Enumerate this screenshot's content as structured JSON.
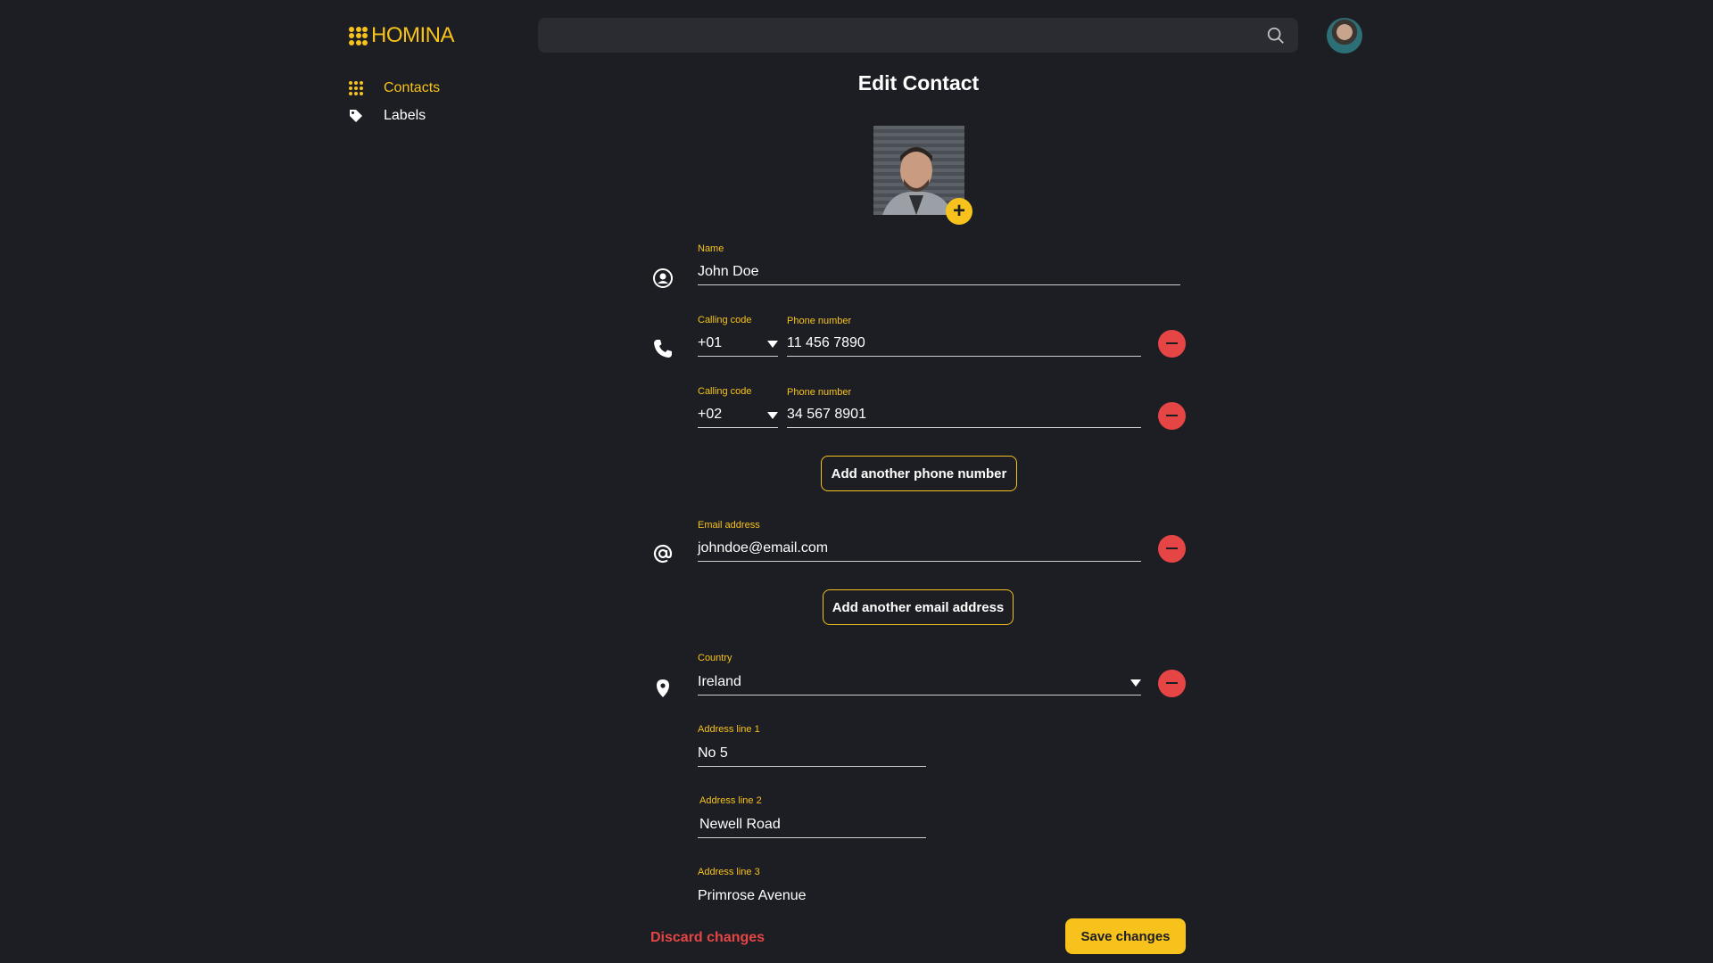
{
  "app": {
    "name": "HOMINA",
    "brand_color": "#f7c21b"
  },
  "search": {
    "placeholder": "",
    "value": "",
    "icon": "search-icon"
  },
  "sidebar": {
    "items": [
      {
        "label": "Contacts",
        "icon": "contacts-grid-icon",
        "active": true
      },
      {
        "label": "Labels",
        "icon": "tag-icon",
        "active": false
      }
    ]
  },
  "page": {
    "title": "Edit Contact"
  },
  "photo": {
    "add_icon": "plus-icon"
  },
  "form": {
    "name": {
      "label": "Name",
      "value": "John Doe",
      "icon": "person-circle-icon"
    },
    "phones": [
      {
        "calling_code_label": "Calling code",
        "calling_code": "+01",
        "phone_label": "Phone number",
        "phone": "11 456 7890"
      },
      {
        "calling_code_label": "Calling code",
        "calling_code": "+02",
        "phone_label": "Phone number",
        "phone": "34 567 8901"
      }
    ],
    "phone_icon": "phone-icon",
    "add_phone_label": "Add another phone number",
    "email": {
      "label": "Email address",
      "value": "johndoe@email.com",
      "icon": "at-icon"
    },
    "add_email_label": "Add another email address",
    "address": {
      "icon": "location-pin-icon",
      "country_label": "Country",
      "country": "Ireland",
      "line1_label": "Address line 1",
      "line1": "No 5",
      "line2_label": "Address line 2",
      "line2": "Newell Road",
      "line3_label": "Address line 3",
      "line3": "Primrose Avenue"
    }
  },
  "actions": {
    "discard_label": "Discard changes",
    "save_label": "Save changes"
  },
  "colors": {
    "background": "#1c1e23",
    "accent": "#f7c21b",
    "danger": "#e64545"
  }
}
